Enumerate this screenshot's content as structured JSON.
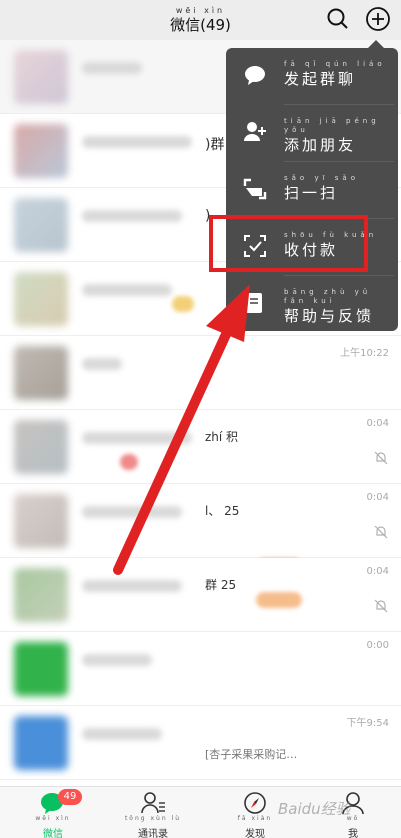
{
  "header": {
    "title_pinyin": "wēi xìn",
    "title": "微信(49)"
  },
  "menu": {
    "items": [
      {
        "pinyin": "fā qǐ qún liáo",
        "label": "发起群聊",
        "icon": "chat-bubble-icon"
      },
      {
        "pinyin": "tiān jiā péng yǒu",
        "label": "添加朋友",
        "icon": "add-friend-icon"
      },
      {
        "pinyin": "sǎo yī sǎo",
        "label": "扫一扫",
        "icon": "scan-icon"
      },
      {
        "pinyin": "shōu fù kuǎn",
        "label": "收付款",
        "icon": "payment-icon"
      },
      {
        "pinyin": "bāng zhù yǔ fǎn kuì",
        "label": "帮助与反馈",
        "icon": "help-feedback-icon"
      }
    ]
  },
  "chats": {
    "row2_frag": ")群",
    "row3_frag": ")",
    "row5_time": "上午10:22",
    "row6_frag": "zhí 积",
    "row6_time": "0:04",
    "row7_frag": "l、 25",
    "row7_time": "0:04",
    "row8_frag": "群 25",
    "row8_time": "0:04",
    "row9_time": "0:00",
    "row10_time": "下午9:54",
    "row10_msg": "[杏子采果采购记…"
  },
  "tabbar": {
    "tabs": [
      {
        "pinyin": "wēi xìn",
        "label": "微信",
        "icon": "chats-icon",
        "active": true
      },
      {
        "pinyin": "tōng xùn lù",
        "label": "通讯录",
        "icon": "contacts-icon",
        "active": false
      },
      {
        "pinyin": "fā xiàn",
        "label": "发现",
        "icon": "discover-icon",
        "active": false
      },
      {
        "pinyin": "wǒ",
        "label": "我",
        "icon": "me-icon",
        "active": false
      }
    ],
    "badge": "49"
  },
  "watermark": "Baidu经验",
  "colors": {
    "accent": "#07c160",
    "menu_bg": "#4c4c4c",
    "annotation": "#e02222",
    "badge": "#fa5151"
  }
}
